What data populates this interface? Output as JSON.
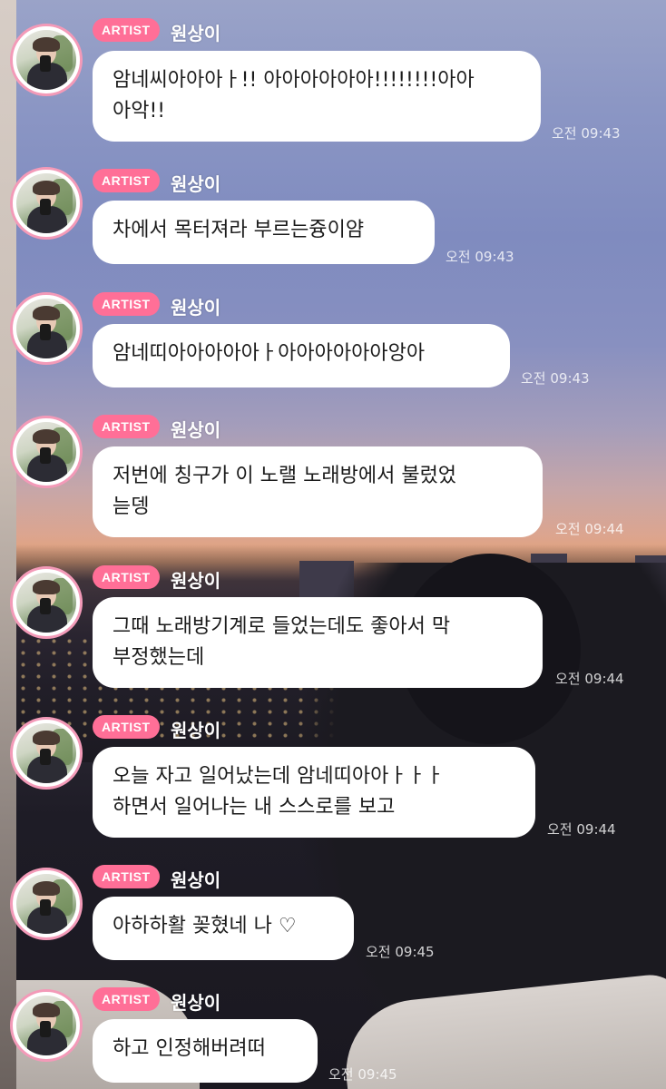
{
  "colors": {
    "badge_bg": "#ff6f97",
    "avatar_ring": "#f39ab8",
    "bubble_bg": "#ffffff",
    "name_text": "#ffffff"
  },
  "icons": [
    "profile-avatar"
  ],
  "messages": [
    {
      "badge": "ARTIST",
      "name": "원상이",
      "text": "암네씨아아아ㅏ!! 아아아아아아!!!!!!!!아아\n아악!!",
      "time": "오전 09:43"
    },
    {
      "badge": "ARTIST",
      "name": "원상이",
      "text": "차에서 목터져라 부르는즁이얌",
      "time": "오전 09:43"
    },
    {
      "badge": "ARTIST",
      "name": "원상이",
      "text": "암네띠아아아아아ㅏ아아아아아아앙아",
      "time": "오전 09:43"
    },
    {
      "badge": "ARTIST",
      "name": "원상이",
      "text": "저번에 칭구가 이 노랠 노래방에서 불렀었\n늗뎅",
      "time": "오전 09:44"
    },
    {
      "badge": "ARTIST",
      "name": "원상이",
      "text": "그때 노래방기계로 들었는데도 좋아서 막\n부정했는데",
      "time": "오전 09:44"
    },
    {
      "badge": "ARTIST",
      "name": "원상이",
      "text": "오늘 자고 일어났는데 암네띠아아ㅏㅏㅏ\n하면서 일어나는 내 스스로를 보고",
      "time": "오전 09:44"
    },
    {
      "badge": "ARTIST",
      "name": "원상이",
      "text": "아하하활 꽂혔네 나 ♡",
      "time": "오전 09:45"
    },
    {
      "badge": "ARTIST",
      "name": "원상이",
      "text": "하고 인정해버려떠",
      "time": "오전 09:45"
    }
  ]
}
